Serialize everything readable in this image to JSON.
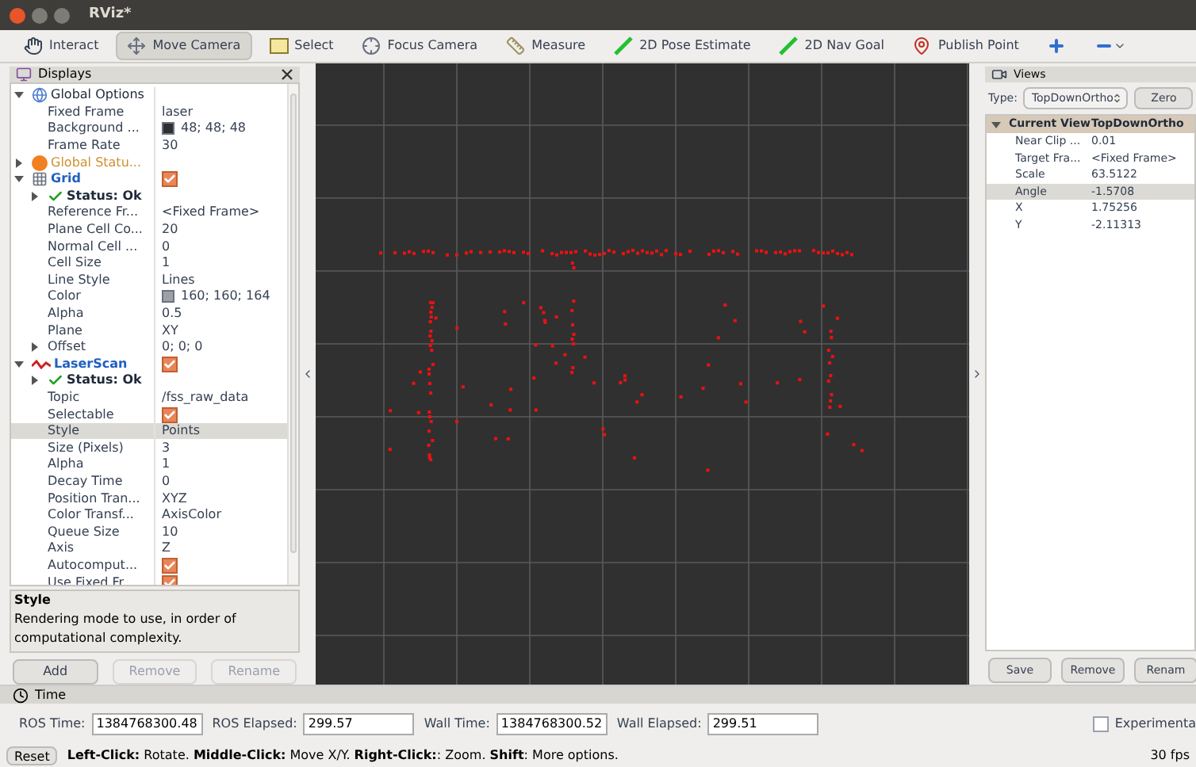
{
  "window": {
    "title": "RViz*"
  },
  "toolbar": [
    {
      "label": "Interact",
      "kind": "hand",
      "selected": false
    },
    {
      "label": "Move Camera",
      "kind": "move",
      "selected": true
    },
    {
      "label": "Select",
      "kind": "select",
      "selected": false
    },
    {
      "label": "Focus Camera",
      "kind": "focus",
      "selected": false
    },
    {
      "label": "Measure",
      "kind": "ruler",
      "selected": false
    },
    {
      "label": "2D Pose Estimate",
      "kind": "pose",
      "selected": false
    },
    {
      "label": "2D Nav Goal",
      "kind": "pose",
      "selected": false
    },
    {
      "label": "Publish Point",
      "kind": "pin",
      "selected": false
    },
    {
      "kind": "plus",
      "selected": false
    },
    {
      "kind": "minus",
      "selected": false
    }
  ],
  "displays": {
    "title": "Displays",
    "tree": [
      {
        "kind": "group",
        "label": "Global Options",
        "expanded": true,
        "selected": false,
        "children": [
          {
            "kind": "property",
            "label": "Fixed Frame",
            "value": "laser",
            "selected": false
          },
          {
            "kind": "color",
            "label": "Background ...",
            "value": "48; 48; 48",
            "color": "#303030",
            "selected": false
          },
          {
            "kind": "property",
            "label": "Frame Rate",
            "value": "30",
            "selected": false
          }
        ]
      },
      {
        "kind": "warning",
        "label": "Global Statu...",
        "expanded": false,
        "selected": false
      },
      {
        "kind": "grid",
        "label": "Grid",
        "expanded": true,
        "checked": true,
        "selected": false,
        "children": [
          {
            "kind": "status",
            "label": "Status: Ok",
            "expanded": false,
            "selected": false
          },
          {
            "kind": "property",
            "label": "Reference Fr...",
            "value": "<Fixed Frame>",
            "selected": false
          },
          {
            "kind": "property",
            "label": "Plane Cell Co...",
            "value": "20",
            "selected": false
          },
          {
            "kind": "property",
            "label": "Normal Cell ...",
            "value": "0",
            "selected": false
          },
          {
            "kind": "property",
            "label": "Cell Size",
            "value": "1",
            "selected": false
          },
          {
            "kind": "property",
            "label": "Line Style",
            "value": "Lines",
            "selected": false
          },
          {
            "kind": "color",
            "label": "Color",
            "value": "160; 160; 164",
            "color": "#a0a0a4",
            "selected": false
          },
          {
            "kind": "property",
            "label": "Alpha",
            "value": "0.5",
            "selected": false
          },
          {
            "kind": "property",
            "label": "Plane",
            "value": "XY",
            "selected": false
          },
          {
            "kind": "property",
            "label": "Offset",
            "value": "0; 0; 0",
            "expanded": false,
            "selected": false
          }
        ]
      },
      {
        "kind": "laser",
        "label": "LaserScan",
        "expanded": true,
        "checked": true,
        "selected": false,
        "children": [
          {
            "kind": "status",
            "label": "Status: Ok",
            "expanded": false,
            "selected": false
          },
          {
            "kind": "property",
            "label": "Topic",
            "value": "/fss_raw_data",
            "selected": false
          },
          {
            "kind": "checkbox",
            "label": "Selectable",
            "checked": true,
            "selected": false
          },
          {
            "kind": "property",
            "label": "Style",
            "value": "Points",
            "selected": true
          },
          {
            "kind": "property",
            "label": "Size (Pixels)",
            "value": "3",
            "selected": false
          },
          {
            "kind": "property",
            "label": "Alpha",
            "value": "1",
            "selected": false
          },
          {
            "kind": "property",
            "label": "Decay Time",
            "value": "0",
            "selected": false
          },
          {
            "kind": "property",
            "label": "Position Tran...",
            "value": "XYZ",
            "selected": false
          },
          {
            "kind": "property",
            "label": "Color Transf...",
            "value": "AxisColor",
            "selected": false
          },
          {
            "kind": "property",
            "label": "Queue Size",
            "value": "10",
            "selected": false
          },
          {
            "kind": "property",
            "label": "Axis",
            "value": "Z",
            "selected": false
          },
          {
            "kind": "checkbox",
            "label": "Autocomput...",
            "checked": true,
            "selected": false
          },
          {
            "kind": "checkbox",
            "label": "Use Fixed Fr...",
            "checked": true,
            "selected": false
          }
        ]
      }
    ],
    "description": {
      "title": "Style",
      "text": "Rendering mode to use, in order of computational complexity."
    },
    "buttons": [
      {
        "label": "Add",
        "disabled": false
      },
      {
        "label": "Remove",
        "disabled": true
      },
      {
        "label": "Rename",
        "disabled": true
      }
    ]
  },
  "views": {
    "title": "Views",
    "type_label": "Type:",
    "type_value": "TopDownOrtho",
    "zero_button": "Zero",
    "header": {
      "label": "Current View",
      "value": "TopDownOrtho",
      "expanded": true
    },
    "rows": [
      {
        "label": "Near Clip ...",
        "value": "0.01",
        "selected": false
      },
      {
        "label": "Target Fra...",
        "value": "<Fixed Frame>",
        "selected": false
      },
      {
        "label": "Scale",
        "value": "63.5122",
        "selected": false
      },
      {
        "label": "Angle",
        "value": "-1.5708",
        "selected": true
      },
      {
        "label": "X",
        "value": "1.75256",
        "selected": false
      },
      {
        "label": "Y",
        "value": "-2.11313",
        "selected": false
      }
    ],
    "buttons": [
      "Save",
      "Remove",
      "Renam"
    ]
  },
  "time": {
    "title": "Time",
    "fields": [
      {
        "label": "ROS Time:",
        "value": "1384768300.48"
      },
      {
        "label": "ROS Elapsed:",
        "value": "299.57"
      },
      {
        "label": "Wall Time:",
        "value": "1384768300.52"
      },
      {
        "label": "Wall Elapsed:",
        "value": "299.51"
      }
    ],
    "experimental": {
      "label": "Experimenta",
      "checked": false
    }
  },
  "status_bar": {
    "reset": "Reset",
    "hint": "**Left-Click:** Rotate. **Middle-Click:** Move X/Y. **Right-Click:**: Zoom. **Shift**: More options.",
    "fps": "30 fps"
  }
}
